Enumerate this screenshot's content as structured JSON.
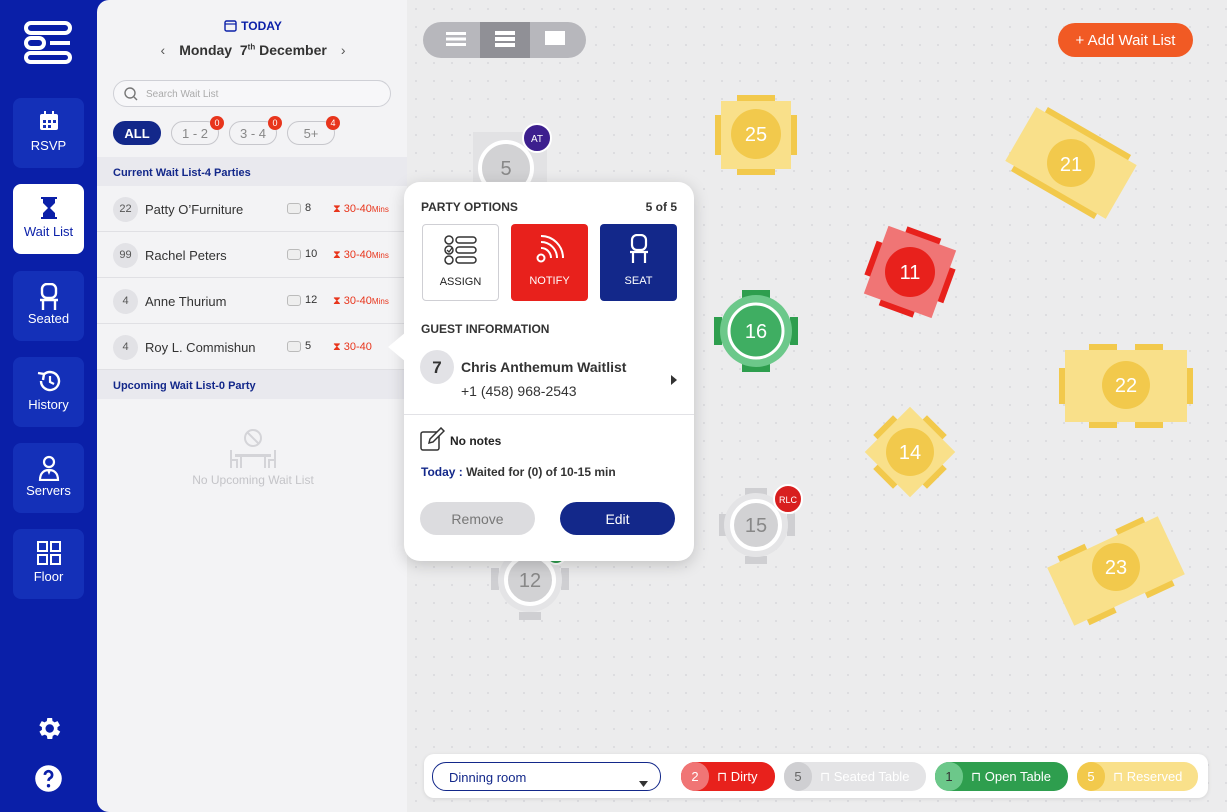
{
  "nav": {
    "items": [
      {
        "label": "RSVP",
        "icon": "calendar-icon"
      },
      {
        "label": "Wait List",
        "icon": "hourglass-icon",
        "active": true
      },
      {
        "label": "Seated",
        "icon": "chair-icon"
      },
      {
        "label": "History",
        "icon": "history-icon"
      },
      {
        "label": "Servers",
        "icon": "server-person-icon"
      },
      {
        "label": "Floor",
        "icon": "grid-icon"
      }
    ],
    "bottom_icons": [
      "gear-icon",
      "help-icon"
    ]
  },
  "panel": {
    "today_label": "TODAY",
    "date_day": "Monday",
    "date_num": "7",
    "date_suffix": "th",
    "date_month": "December",
    "search_placeholder": "Search Wait List",
    "chips": [
      {
        "label": "ALL",
        "active": true
      },
      {
        "label": "1 - 2",
        "count": "0"
      },
      {
        "label": "3 - 4",
        "count": "0"
      },
      {
        "label": "5+",
        "count": "4"
      }
    ],
    "current_header": "Current Wait List-4 Parties",
    "rows": [
      {
        "num": "22",
        "name": "Patty O’Furniture",
        "size": "8",
        "wait": "30-40",
        "unit": "Mins"
      },
      {
        "num": "99",
        "name": "Rachel Peters",
        "size": "10",
        "wait": "30-40",
        "unit": "Mins"
      },
      {
        "num": "4",
        "name": "Anne Thurium",
        "size": "12",
        "wait": "30-40",
        "unit": "Mins"
      },
      {
        "num": "4",
        "name": "Roy L. Commishun",
        "size": "5",
        "wait": "30-40",
        "unit": ""
      }
    ],
    "upcoming_header": "Upcoming  Wait List-0 Party",
    "empty_text": "No Upcoming Wait List"
  },
  "floor": {
    "add_button": "+ Add Wait List",
    "tables": [
      {
        "id": "25",
        "status": "reserved"
      },
      {
        "id": "21",
        "status": "reserved"
      },
      {
        "id": "5",
        "status": "seated",
        "tag": "AT"
      },
      {
        "id": "11",
        "status": "dirty"
      },
      {
        "id": "16",
        "status": "open"
      },
      {
        "id": "22",
        "status": "reserved"
      },
      {
        "id": "14",
        "status": "reserved"
      },
      {
        "id": "15",
        "status": "seated",
        "tag": "RLC"
      },
      {
        "id": "12",
        "status": "seated"
      },
      {
        "id": "23",
        "status": "reserved"
      }
    ]
  },
  "popup": {
    "title": "PARTY OPTIONS",
    "counter": "5 of 5",
    "options": [
      {
        "label": "ASSIGN",
        "icon": "assign-list-icon"
      },
      {
        "label": "NOTIFY",
        "icon": "notify-signal-icon"
      },
      {
        "label": "SEAT",
        "icon": "chair-icon"
      }
    ],
    "guest_header": "GUEST INFORMATION",
    "guest_num": "7",
    "guest_name": "Chris Anthemum Waitlist",
    "guest_phone": "+1 (458) 968-2543",
    "notes": "No notes",
    "today_label": "Today :",
    "waited": " Waited for (0) of 10-15 min",
    "remove_label": "Remove",
    "edit_label": "Edit"
  },
  "legend": {
    "room": "Dinning room",
    "items": [
      {
        "count": "2",
        "label": "Dirty",
        "color": "#e8211c"
      },
      {
        "count": "5",
        "label": "Seated Table",
        "color": "#d9d9dc"
      },
      {
        "count": "1",
        "label": "Open Table",
        "color": "#2e9e4e"
      },
      {
        "count": "5",
        "label": "Reserved",
        "color": "#f9e08a"
      }
    ]
  },
  "colors": {
    "brand": "#0a1fa8",
    "accent": "#f15a24",
    "dirty": "#e8211c",
    "open": "#2e9e4e",
    "reserved": "#f2c94c"
  }
}
